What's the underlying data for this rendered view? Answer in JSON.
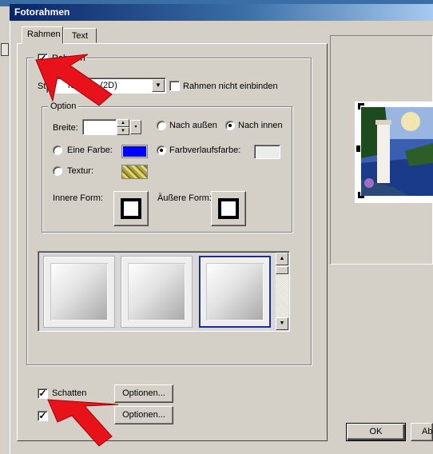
{
  "window": {
    "title": "Fotorahmen"
  },
  "tabs": [
    {
      "label": "Rahmen",
      "active": true
    },
    {
      "label": "Text",
      "active": false
    }
  ],
  "frame_group": {
    "checkbox_label": "Rahmen",
    "checked": true,
    "style_label": "St",
    "style_value": "rahmen (2D)",
    "no_bind_label": "Rahmen nicht einbinden",
    "no_bind_checked": false
  },
  "options_group": {
    "legend": "Option",
    "width_label": "Breite:",
    "width_value": "",
    "outside_label": "Nach außen",
    "inside_label": "Nach innen",
    "placement_selected": "Nach innen",
    "color_label": "Eine Farbe:",
    "color_value": "#0000ff",
    "gradient_label": "Farbverlaufsfarbe:",
    "texture_label": "Textur:",
    "fill_selected": "Farbverlaufsfarbe:",
    "inner_shape_label": "Innere Form:",
    "outer_shape_label": "Äußere Form:"
  },
  "frame_gallery": {
    "tiles": 3,
    "selected_index": 2
  },
  "shadow": {
    "label": "Schatten",
    "checked": true,
    "options_label": "Optionen..."
  },
  "second_option": {
    "label": "",
    "checked": true,
    "options_label": "Optionen..."
  },
  "buttons": {
    "ok": "OK",
    "cancel_partial": "Ab"
  }
}
